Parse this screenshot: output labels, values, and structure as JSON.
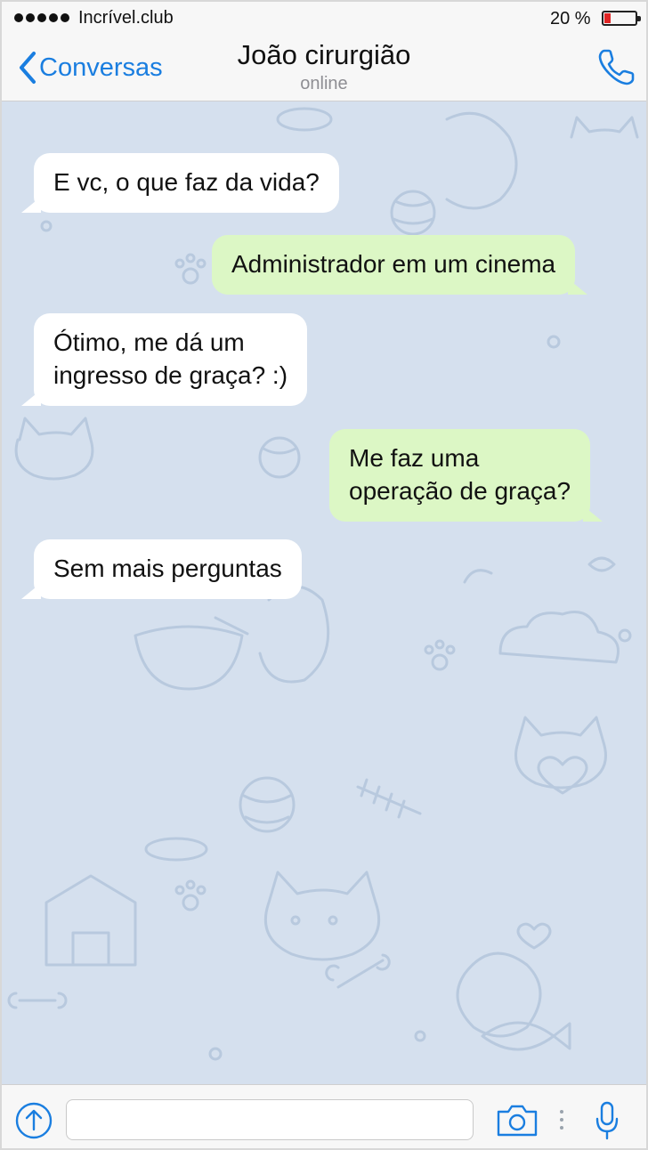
{
  "status_bar": {
    "carrier": "Incrível.club",
    "battery_percent": "20 %",
    "battery_level": 0.2,
    "signal_bars": 5
  },
  "nav": {
    "back_label": "Conversas",
    "contact_name": "João cirurgião",
    "contact_status": "online"
  },
  "messages": [
    {
      "direction": "incoming",
      "text": "E vc, o que faz da vida?"
    },
    {
      "direction": "outgoing",
      "text": "Administrador em um cinema"
    },
    {
      "direction": "incoming",
      "text": "Ótimo, me dá um\ningresso de graça? :)"
    },
    {
      "direction": "outgoing",
      "text": "Me faz uma\noperação de graça?"
    },
    {
      "direction": "incoming",
      "text": "Sem mais perguntas"
    }
  ],
  "input_bar": {
    "placeholder": "",
    "icons": [
      "upload-arrow-icon",
      "camera-icon",
      "more-dots-icon",
      "microphone-icon"
    ]
  },
  "colors": {
    "accent": "#1a7ee0",
    "chat_background": "#d5e0ee",
    "incoming_bubble": "#ffffff",
    "outgoing_bubble": "#dcf7c5",
    "battery_low": "#e02424"
  }
}
